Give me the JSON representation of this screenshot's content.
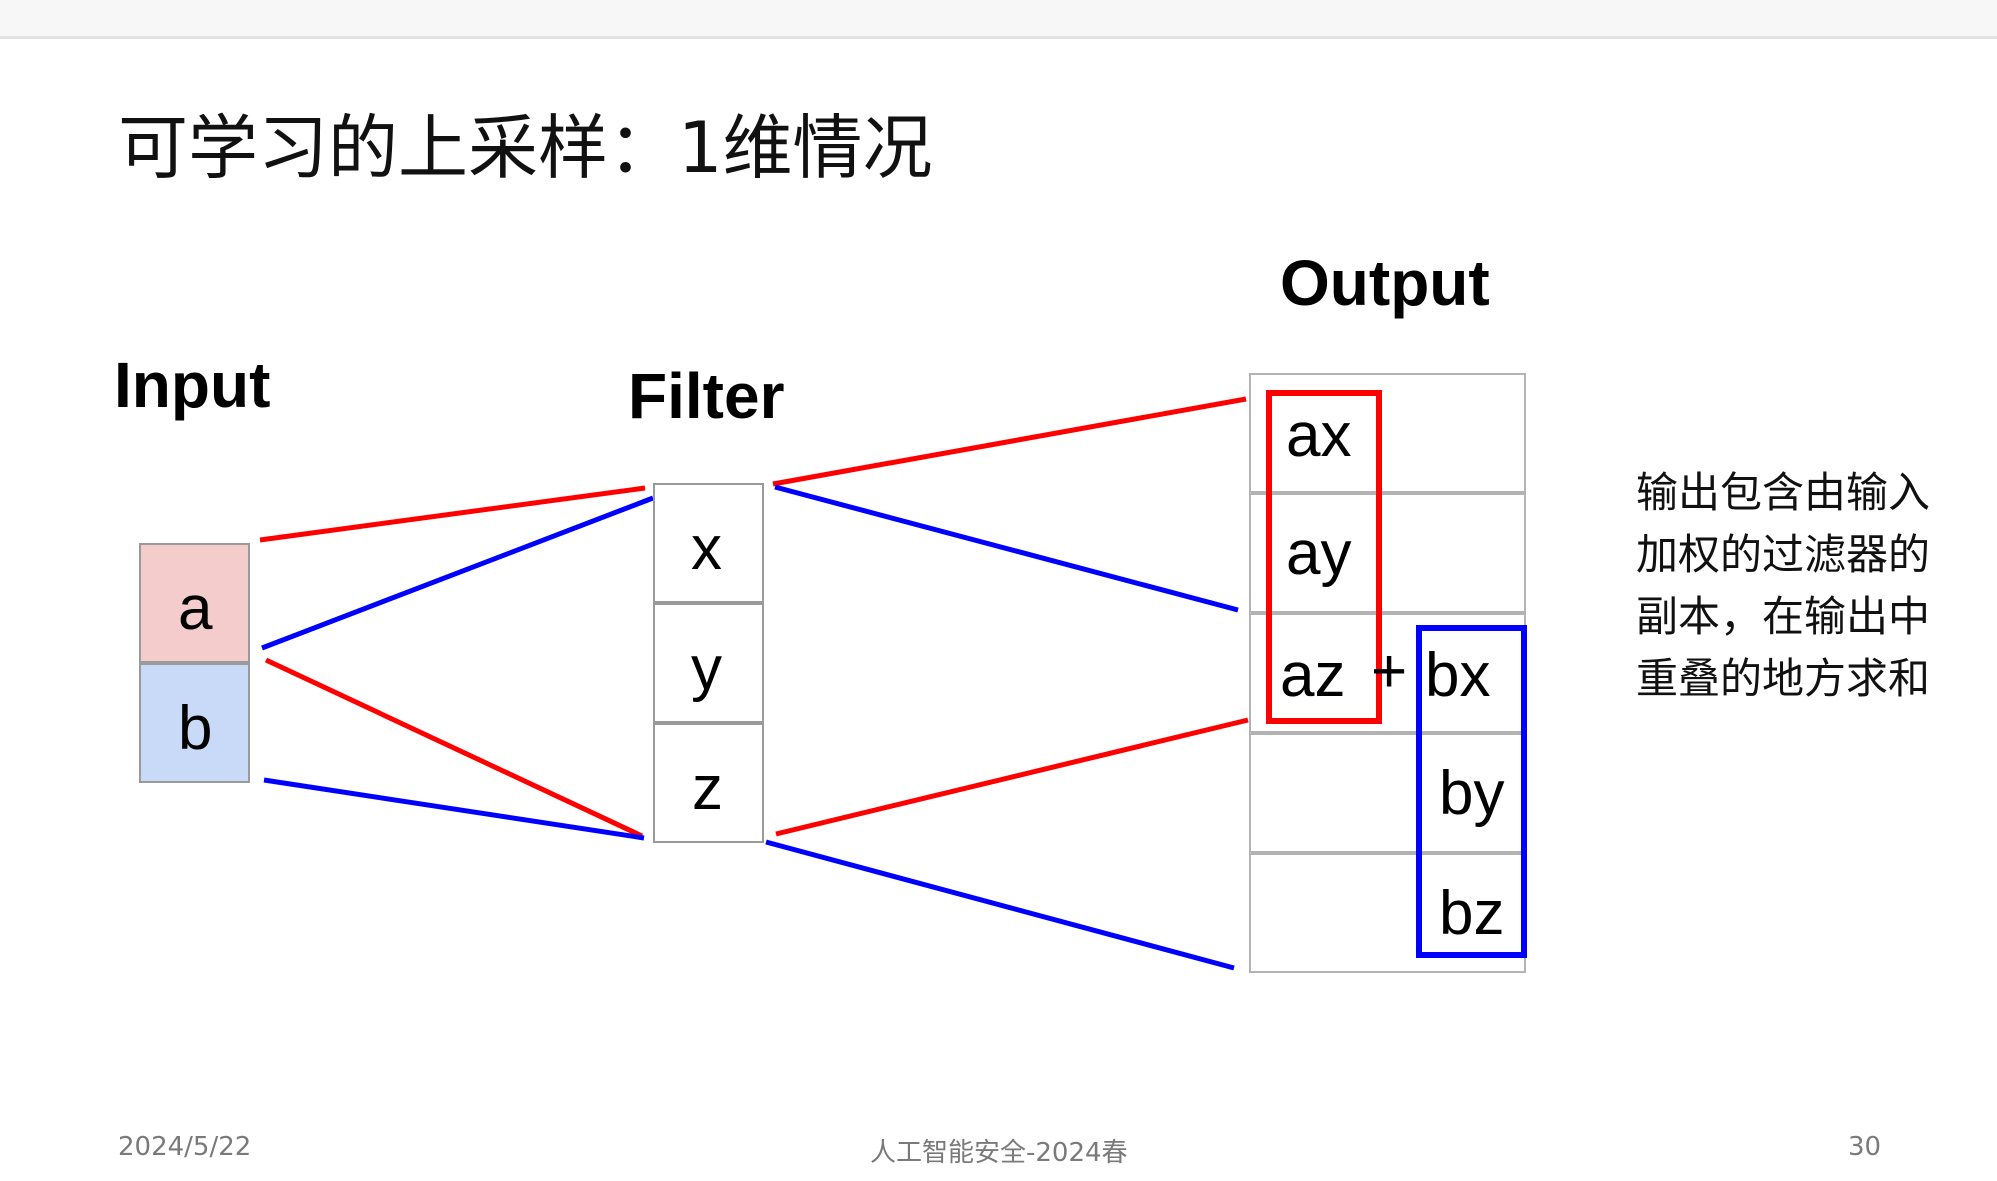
{
  "slide": {
    "title": "可学习的上采样：1维情况",
    "note": "输出包含由输入加权的过滤器的副本，在输出中重叠的地方求和",
    "footer": {
      "date": "2024/5/22",
      "course": "人工智能安全-2024春",
      "page": "30"
    }
  },
  "diagram": {
    "input_label": "Input",
    "filter_label": "Filter",
    "output_label": "Output",
    "input_cells": [
      "a",
      "b"
    ],
    "filter_cells": [
      "x",
      "y",
      "z"
    ],
    "output_a_terms": [
      "ax",
      "ay",
      "az"
    ],
    "plus": "+",
    "output_b_terms": [
      "bx",
      "by",
      "bz"
    ],
    "colors": {
      "input_a": "#f4cccc",
      "input_b": "#c9daf8",
      "a_path": "#ff0000",
      "b_path": "#0000ff"
    }
  }
}
